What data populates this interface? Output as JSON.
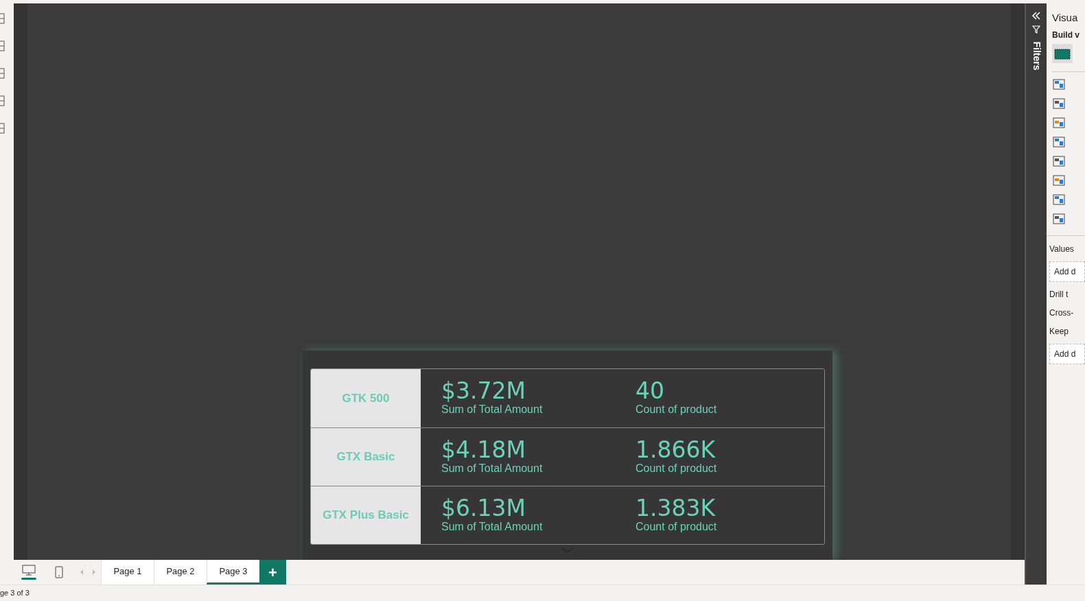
{
  "filters_pane": {
    "label": "Filters"
  },
  "visualizations_pane": {
    "title": "Visua",
    "build_label": "Build v",
    "sections": [
      {
        "kind": "heading",
        "text": "Values"
      },
      {
        "kind": "well",
        "text": "Add d"
      },
      {
        "kind": "heading",
        "text": "Drill t"
      },
      {
        "kind": "text",
        "text": "Cross-"
      },
      {
        "kind": "text",
        "text": "Keep"
      },
      {
        "kind": "well",
        "text": "Add d"
      }
    ]
  },
  "card_visual": {
    "rows": [
      {
        "category": "GTK 500",
        "amount": "$3.72M",
        "amount_label": "Sum of Total Amount",
        "count": "40",
        "count_label": "Count of product"
      },
      {
        "category": "GTX Basic",
        "amount": "$4.18M",
        "amount_label": "Sum of Total Amount",
        "count": "1.866K",
        "count_label": "Count of product"
      },
      {
        "category": "GTX Plus Basic",
        "amount": "$6.13M",
        "amount_label": "Sum of Total Amount",
        "count": "1.383K",
        "count_label": "Count of product"
      }
    ]
  },
  "page_tabs": [
    {
      "label": "Page 1",
      "selected": false
    },
    {
      "label": "Page 2",
      "selected": false
    },
    {
      "label": "Page 3",
      "selected": true
    }
  ],
  "add_page_button": "+",
  "status_bar": {
    "page_info": "ge 3 of 3"
  }
}
